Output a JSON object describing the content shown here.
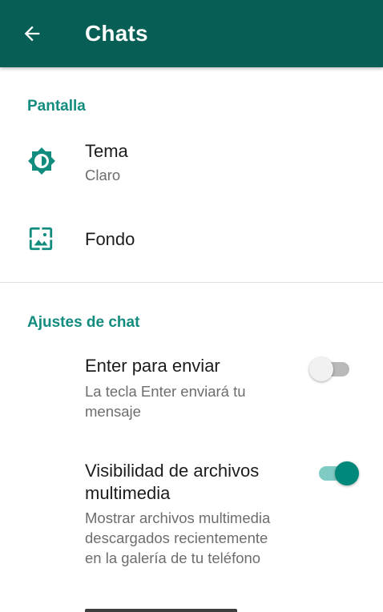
{
  "header": {
    "title": "Chats",
    "back_icon": "arrow-left-icon"
  },
  "colors": {
    "header_bg": "#075e54",
    "accent": "#128c7e",
    "switch_on": "#00897b"
  },
  "sections": {
    "display": {
      "header": "Pantalla",
      "theme": {
        "title": "Tema",
        "value": "Claro",
        "icon": "brightness-icon"
      },
      "wallpaper": {
        "title": "Fondo",
        "icon": "wallpaper-icon"
      }
    },
    "chat_settings": {
      "header": "Ajustes de chat",
      "enter_to_send": {
        "title": "Enter para enviar",
        "subtitle_line1": "La tecla Enter enviará tu",
        "subtitle_line2": "mensaje",
        "enabled": false
      },
      "media_visibility": {
        "title_line1": "Visibilidad de archivos",
        "title_line2": "multimedia",
        "subtitle_line1": "Mostrar archivos multimedia",
        "subtitle_line2": "descargados recientemente",
        "subtitle_line3": "en la galería de tu teléfono",
        "enabled": true
      }
    }
  }
}
